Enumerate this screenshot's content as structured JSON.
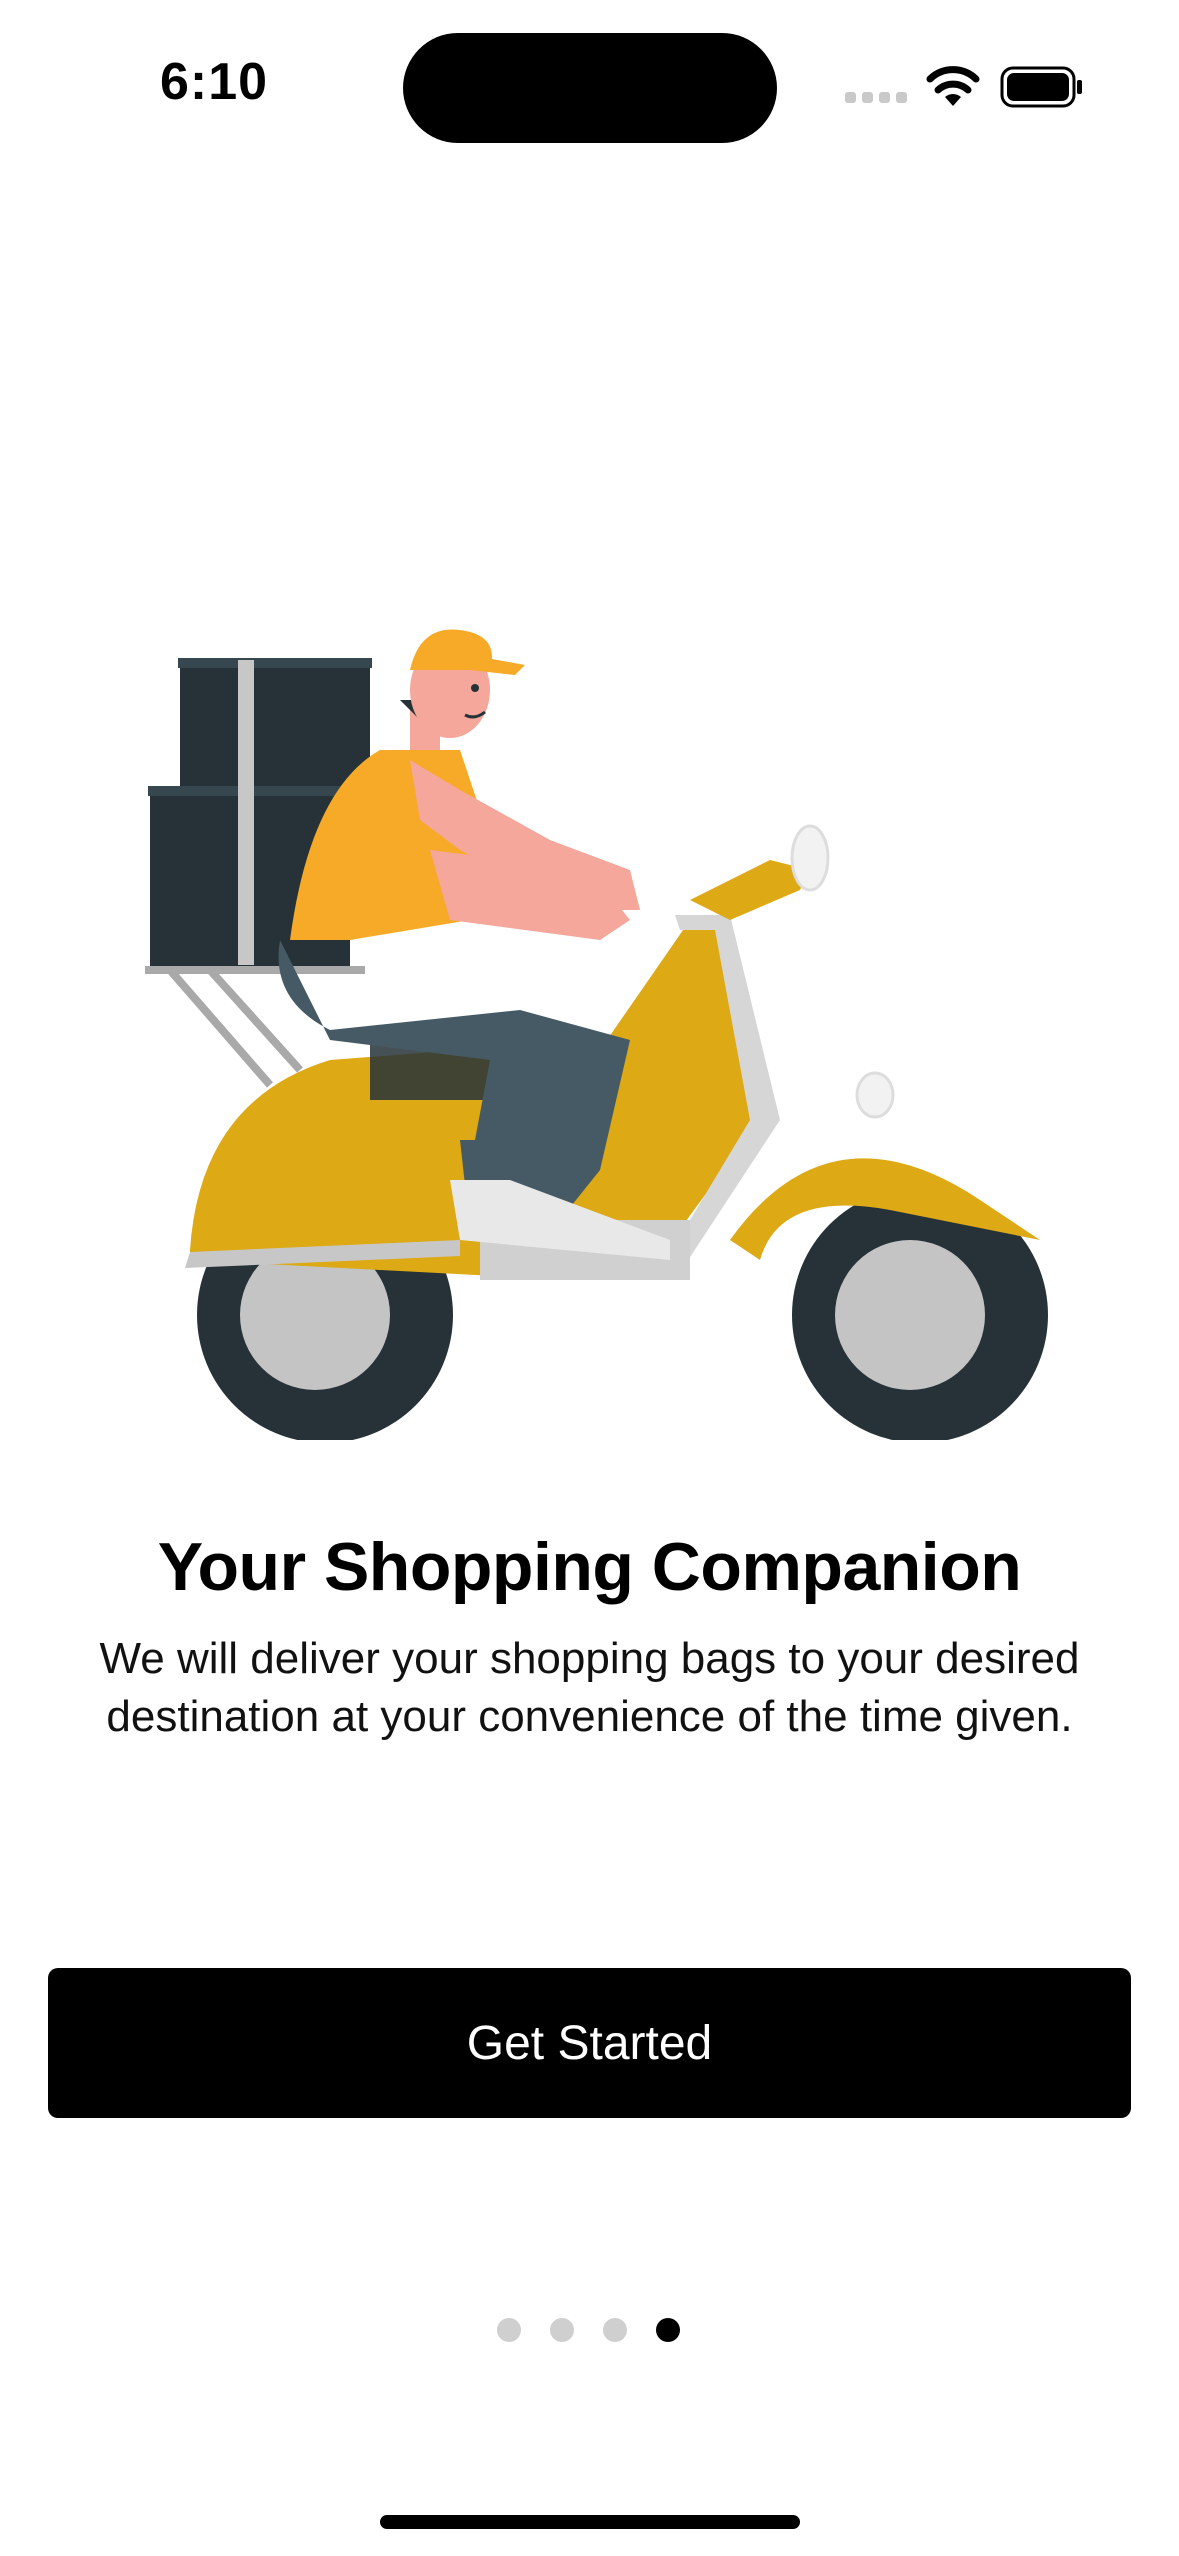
{
  "status_bar": {
    "time": "6:10",
    "icons": [
      "cellular-signal-icon",
      "wifi-icon",
      "battery-icon"
    ]
  },
  "onboarding": {
    "illustration": "delivery-scooter-illustration",
    "title": "Your Shopping Companion",
    "description": "We will deliver your shopping bags to your desired destination at your convenience of the time given.",
    "cta_label": "Get Started",
    "pager": {
      "total": 4,
      "active_index": 3
    }
  },
  "colors": {
    "accent_yellow": "#DDA915",
    "shirt_orange": "#F7A928",
    "dark_gray": "#263238",
    "pants_gray": "#455A64",
    "skin": "#F4A79A",
    "button_bg": "#000000",
    "button_text": "#FFFFFF"
  }
}
